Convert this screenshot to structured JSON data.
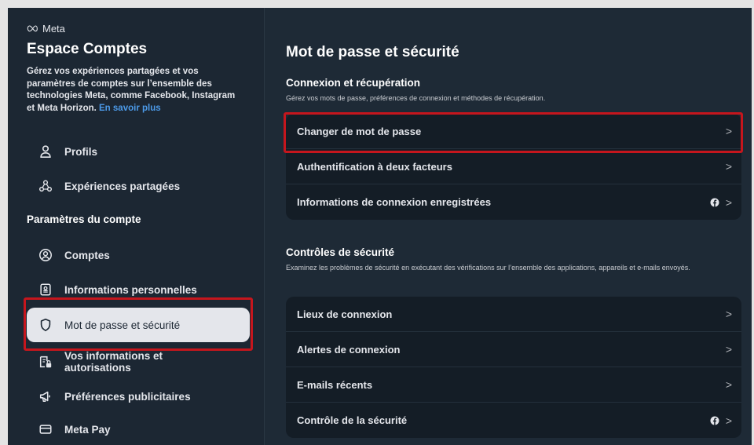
{
  "brand": {
    "name": "Meta"
  },
  "sidebar": {
    "title": "Espace Comptes",
    "description": "Gérez vos expériences partagées et vos paramètres de comptes sur l’ensemble des technologies Meta, comme Facebook, Instagram et Meta Horizon.",
    "learn_more": "En savoir plus",
    "items_top": [
      {
        "label": "Profils",
        "icon": "person-icon"
      },
      {
        "label": "Expériences partagées",
        "icon": "shared-experiences-icon"
      }
    ],
    "settings_label": "Paramètres du compte",
    "items": [
      {
        "label": "Comptes",
        "icon": "account-circle-icon"
      },
      {
        "label": "Informations personnelles",
        "icon": "id-card-icon"
      },
      {
        "label": "Mot de passe et sécurité",
        "icon": "shield-icon",
        "active": true
      },
      {
        "label": "Vos informations et autorisations",
        "icon": "info-lock-icon"
      },
      {
        "label": "Préférences publicitaires",
        "icon": "megaphone-icon"
      },
      {
        "label": "Meta Pay",
        "icon": "card-icon"
      }
    ]
  },
  "main": {
    "title": "Mot de passe et sécurité",
    "login_section": {
      "heading": "Connexion et récupération",
      "subtitle": "Gérez vos mots de passe, préférences de connexion et méthodes de récupération.",
      "rows": [
        "Changer de mot de passe",
        "Authentification à deux facteurs",
        "Informations de connexion enregistrées"
      ]
    },
    "security_section": {
      "heading": "Contrôles de sécurité",
      "subtitle": "Examinez les problèmes de sécurité en exécutant des vérifications sur l’ensemble des applications, appareils et e-mails envoyés.",
      "rows": [
        "Lieux de connexion",
        "Alertes de connexion",
        "E-mails récents",
        "Contrôle de la sécurité"
      ]
    }
  },
  "chevron": ">",
  "colors": {
    "highlight": "#c5161d",
    "link": "#4c9ae8",
    "active_bg": "#e4e6eb"
  }
}
